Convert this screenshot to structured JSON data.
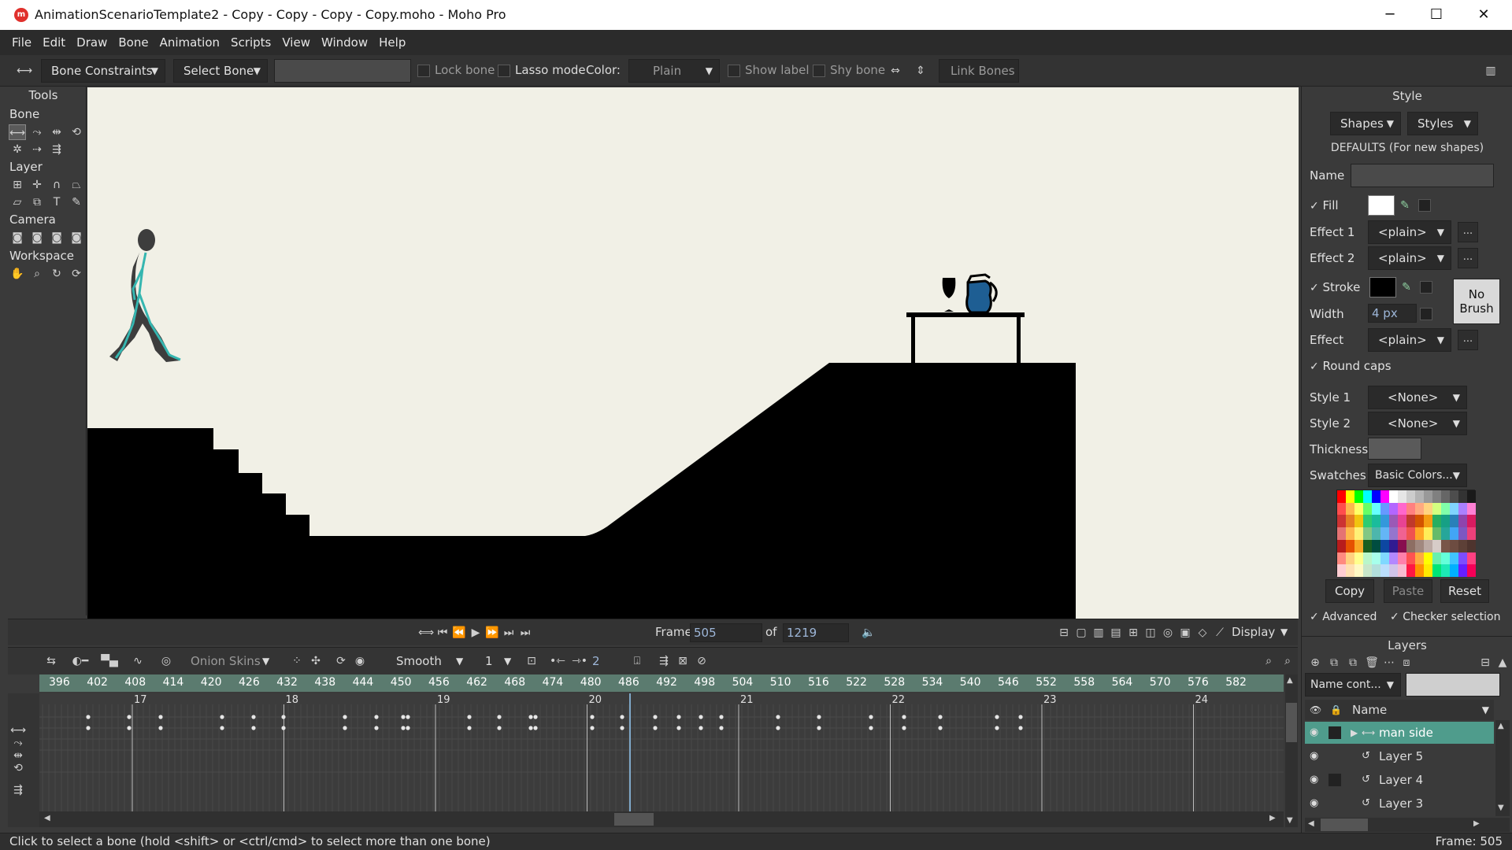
{
  "window": {
    "title": "AnimationScenarioTemplate2 - Copy - Copy - Copy - Copy.moho - Moho Pro",
    "minimize": "─",
    "maximize": "☐",
    "close": "✕",
    "app_icon_text": "m"
  },
  "menu": [
    "File",
    "Edit",
    "Draw",
    "Bone",
    "Animation",
    "Scripts",
    "View",
    "Window",
    "Help"
  ],
  "options_bar": {
    "bone_constraints": "Bone Constraints",
    "select_bone": "Select Bone",
    "lock_bone": "Lock bone",
    "lasso_mode": "Lasso mode",
    "color_label": "Color:",
    "color_value": "Plain",
    "show_label": "Show label",
    "shy_bone": "Shy bone",
    "link_bones": "Link Bones"
  },
  "tools": {
    "header": "Tools",
    "bone": "Bone",
    "layer": "Layer",
    "camera": "Camera",
    "workspace": "Workspace"
  },
  "playback": {
    "frame_label": "Frame",
    "frame_value": "505",
    "of_label": "of",
    "total_frames": "1219",
    "display": "Display"
  },
  "timeline": {
    "onion_skins": "Onion Skins",
    "interpolation": "Smooth",
    "keyframe_step": "1",
    "count": "2",
    "ruler_ticks": [
      "396",
      "402",
      "408",
      "414",
      "420",
      "426",
      "432",
      "438",
      "444",
      "450",
      "456",
      "462",
      "468",
      "474",
      "480",
      "486",
      "492",
      "498",
      "504",
      "510",
      "516",
      "522",
      "528",
      "534",
      "540",
      "546",
      "552",
      "558",
      "564",
      "570",
      "576",
      "582"
    ],
    "second_marks": [
      "17",
      "18",
      "19",
      "20",
      "21",
      "22",
      "23",
      "24"
    ]
  },
  "style_panel": {
    "header": "Style",
    "shapes": "Shapes",
    "styles": "Styles",
    "defaults": "DEFAULTS (For new shapes)",
    "name_label": "Name",
    "fill_label": "Fill",
    "effect1_label": "Effect 1",
    "effect1_value": "<plain>",
    "effect2_label": "Effect 2",
    "effect2_value": "<plain>",
    "stroke_label": "Stroke",
    "width_label": "Width",
    "width_value": "4 px",
    "effect_label": "Effect",
    "effect_value": "<plain>",
    "no_brush_1": "No",
    "no_brush_2": "Brush",
    "round_caps": "Round caps",
    "style1_label": "Style 1",
    "style1_value": "<None>",
    "style2_label": "Style 2",
    "style2_value": "<None>",
    "thickness_label": "Thickness",
    "swatches_label": "Swatches",
    "swatches_value": "Basic Colors...",
    "copy": "Copy",
    "paste": "Paste",
    "reset": "Reset",
    "advanced": "Advanced",
    "checker_selection": "Checker selection",
    "more": "..."
  },
  "layers_panel": {
    "header": "Layers",
    "filter": "Name cont...",
    "name_col": "Name",
    "items": [
      {
        "name": "man side"
      },
      {
        "name": "Layer 5"
      },
      {
        "name": "Layer 4"
      },
      {
        "name": "Layer 3"
      }
    ]
  },
  "status": {
    "hint": "Click to select a bone (hold <shift> or <ctrl/cmd> to select more than one bone)",
    "frame": "Frame: 505"
  },
  "colors": {
    "canvas_bg": "#f1f0e6",
    "ruler": "#5b7b6f",
    "selected_layer": "#4f9c8c",
    "bone": "#35b6b0"
  }
}
